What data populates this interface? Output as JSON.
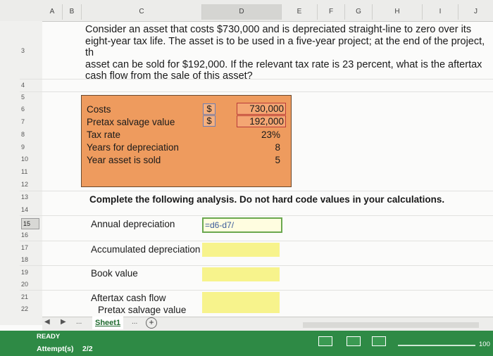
{
  "columns": [
    "A",
    "B",
    "C",
    "D",
    "E",
    "F",
    "G",
    "H",
    "I",
    "J"
  ],
  "rows": [
    "3",
    "4",
    "5",
    "6",
    "7",
    "8",
    "9",
    "10",
    "11",
    "12",
    "13",
    "14",
    "15",
    "16",
    "17",
    "18",
    "19",
    "20",
    "21",
    "22"
  ],
  "question": "Consider an asset that costs $730,000 and is depreciated straight-line to zero over its\neight-year tax life. The asset is to be used in a five-year project; at the end of the project, th\nasset can be sold for $192,000. If the relevant tax rate is 23 percent, what is the aftertax\ncash flow from the sale of this asset?",
  "inputs": {
    "costs_label": "Costs",
    "salvage_label": "Pretax salvage value",
    "tax_label": "Tax rate",
    "years_label": "Years for depreciation",
    "year_sold_label": "Year asset is sold",
    "currency": "$",
    "costs": "730,000",
    "salvage": "192,000",
    "tax": "23%",
    "years": "8",
    "year_sold": "5"
  },
  "instruction": "Complete the following analysis. Do not hard code values in your calculations.",
  "analysis": {
    "annual_dep": "Annual depreciation",
    "accum_dep": "Accumulated depreciation",
    "book_value": "Book value",
    "aftertax_cf": "Aftertax cash flow",
    "pretax_salvage": "Pretax salvage value",
    "formula_text": "=d6-d7/"
  },
  "tabs": {
    "sheet_name": "Sheet1",
    "ellipsis": "...",
    "more": "..."
  },
  "status": {
    "ready": "READY",
    "attempts_label": "Attempt(s)",
    "attempts_value": "2/2",
    "zoom": "100"
  }
}
